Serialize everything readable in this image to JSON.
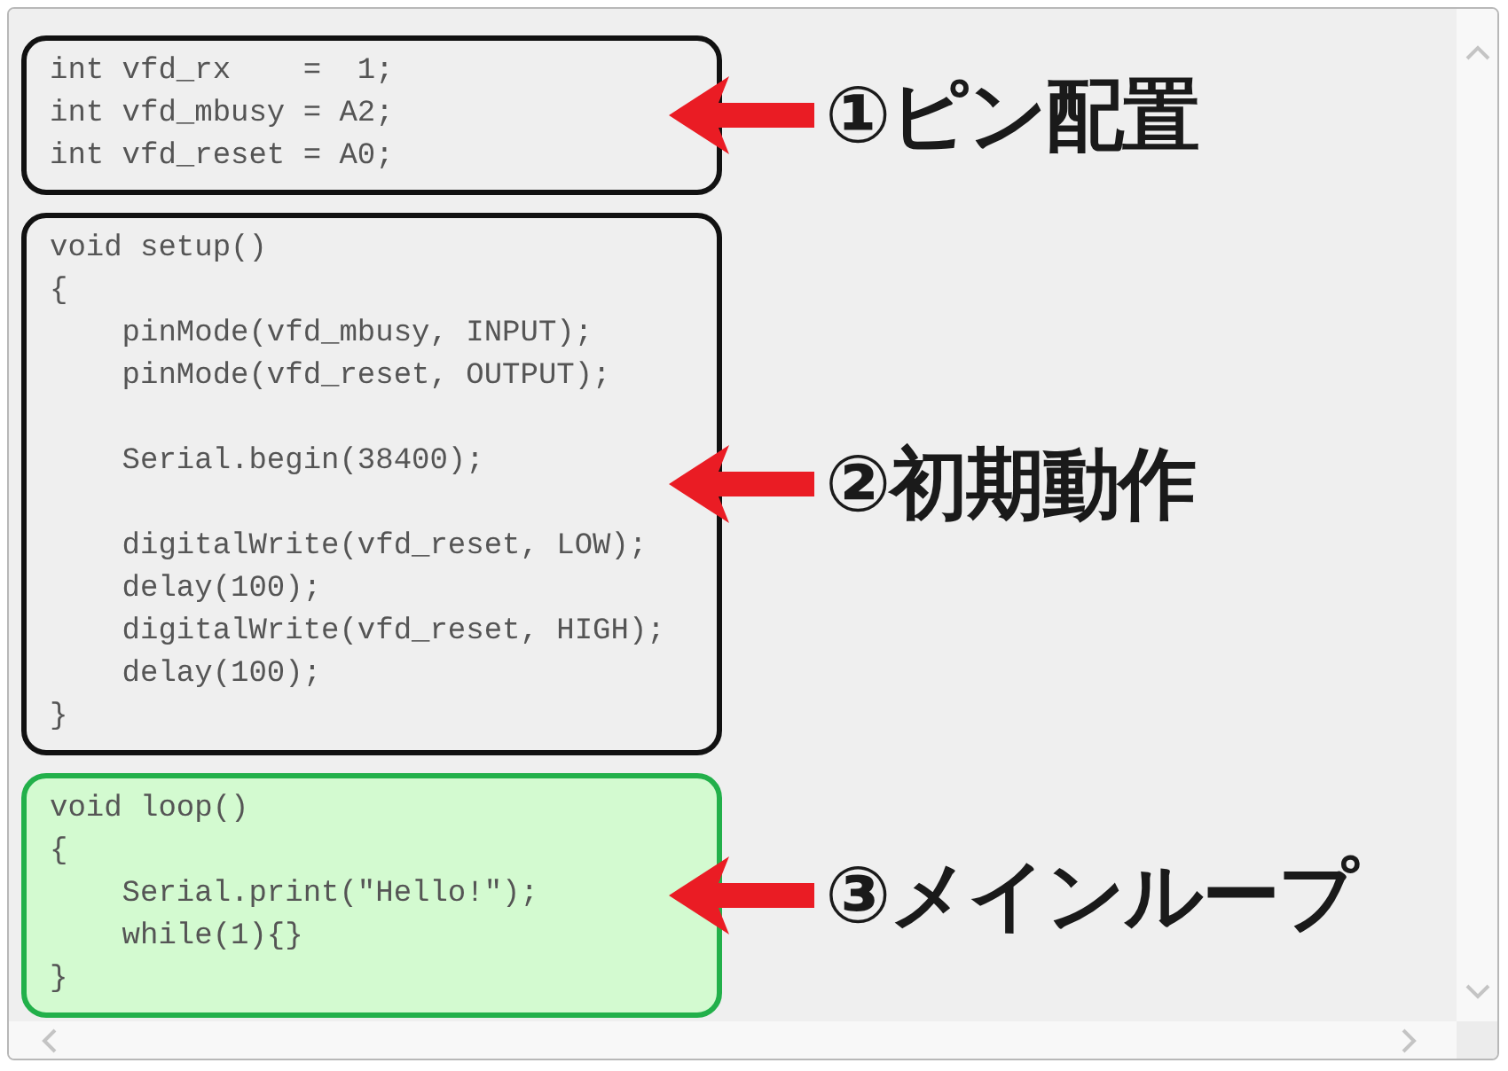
{
  "blocks": [
    {
      "kind": "plain",
      "code": "int vfd_rx    =  1;\nint vfd_mbusy = A2;\nint vfd_reset = A0;",
      "label": "①ピン配置"
    },
    {
      "kind": "plain",
      "code": "void setup()\n{\n    pinMode(vfd_mbusy, INPUT);\n    pinMode(vfd_reset, OUTPUT);\n\n    Serial.begin(38400);\n\n    digitalWrite(vfd_reset, LOW);\n    delay(100);\n    digitalWrite(vfd_reset, HIGH);\n    delay(100);\n}",
      "label": "②初期動作"
    },
    {
      "kind": "highlighted",
      "code": "void loop()\n{\n    Serial.print(\"Hello!\");\n    while(1){}\n}",
      "label": "③メインループ"
    }
  ]
}
